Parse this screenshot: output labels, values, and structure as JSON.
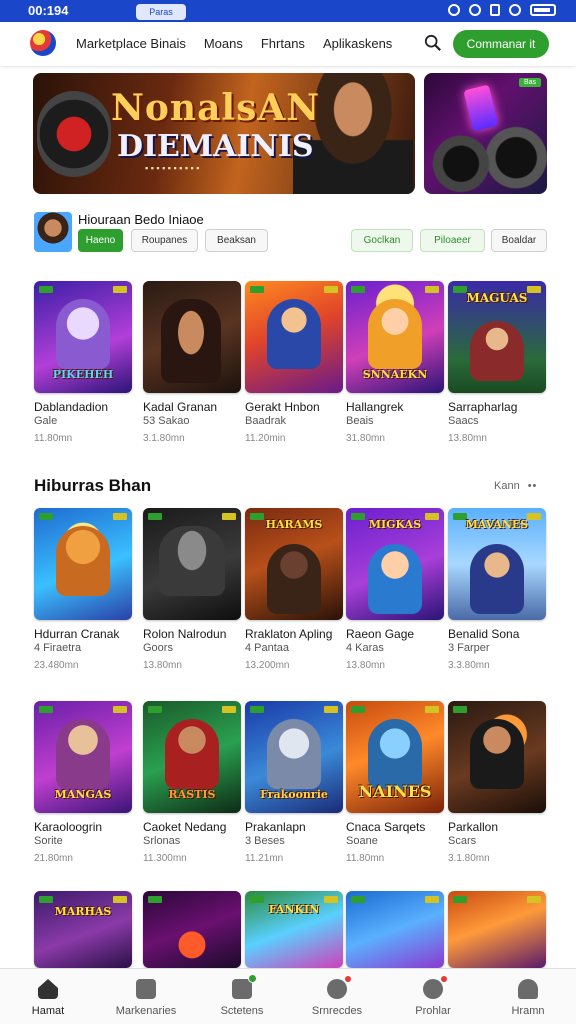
{
  "status_bar": {
    "time": "00:194",
    "pill": "Paras"
  },
  "header": {
    "nav": [
      "Marketplace Binais",
      "Moans",
      "Fhrtans",
      "Aplikaskens"
    ],
    "cta_label": "Commanar it",
    "colors": {
      "accent": "#2e9e2e",
      "brand": "#1a47c9"
    }
  },
  "banner": {
    "title_line1": "NonalsAN",
    "title_line2": "DIEMAINIS",
    "side_tag": "Bas"
  },
  "featured": {
    "title": "Hiouraan Bedo Iniaoe",
    "chips": [
      "Haeno",
      "Roupanes",
      "Beaksan",
      "Goclkan",
      "Piloaeer",
      "Boaldar"
    ]
  },
  "section": {
    "title": "Hiburras Bhan",
    "more_label": "Kann"
  },
  "games_row1": [
    {
      "name": "Dablandadion",
      "sub": "Gale",
      "meta": "11.80mn",
      "logo": "PIKEHEH"
    },
    {
      "name": "Kadal Granan",
      "sub": "53 Sakao",
      "meta": "3.1.80mn",
      "logo": ""
    },
    {
      "name": "Gerakt Hnbon",
      "sub": "Baadrak",
      "meta": "11.20min",
      "logo": ""
    },
    {
      "name": "Hallangrek",
      "sub": "Beais",
      "meta": "31.80mn",
      "logo": "SNNAEKN"
    },
    {
      "name": "Sarrapharlag",
      "sub": "Saacs",
      "meta": "13.80mn",
      "logo": "MAGUAS"
    }
  ],
  "games_row2": [
    {
      "name": "Hdurran Cranak",
      "sub": "4 Firaetra",
      "meta": "23.480mn",
      "logo": ""
    },
    {
      "name": "Rolon Nalrodun",
      "sub": "Goors",
      "meta": "13.80mn",
      "logo": ""
    },
    {
      "name": "Rraklaton Apling",
      "sub": "4 Pantaa",
      "meta": "13.200mn",
      "logo": "HARAMS"
    },
    {
      "name": "Raeon Gage",
      "sub": "4 Karas",
      "meta": "13.80mn",
      "logo": "MIGKAS"
    },
    {
      "name": "Benalid Sona",
      "sub": "3 Farper",
      "meta": "3.3.80mn",
      "logo": "MAVANES"
    }
  ],
  "games_row3": [
    {
      "name": "Karaoloogrin",
      "sub": "Sorite",
      "meta": "21.80mn",
      "logo": "MANGAS"
    },
    {
      "name": "Caoket Nedang",
      "sub": "Srlonas",
      "meta": "11.300mn",
      "logo": "RASTIS"
    },
    {
      "name": "Prakanlapn",
      "sub": "3 Beses",
      "meta": "11.21mn",
      "logo": "Frakoonrie"
    },
    {
      "name": "Cnaca Sarqets",
      "sub": "Soane",
      "meta": "11.80mn",
      "logo": "NAINES"
    },
    {
      "name": "Parkallon",
      "sub": "Scars",
      "meta": "3.1.80mn",
      "logo": ""
    }
  ],
  "games_row4": [
    {
      "logo": "MARHAS"
    },
    {
      "logo": ""
    },
    {
      "logo": "FANKIN"
    },
    {
      "logo": ""
    },
    {
      "logo": ""
    }
  ],
  "bottom_nav": [
    "Hamat",
    "Markenaries",
    "Sctetens",
    "Srnrecdes",
    "Prohlar",
    "Hramn"
  ]
}
